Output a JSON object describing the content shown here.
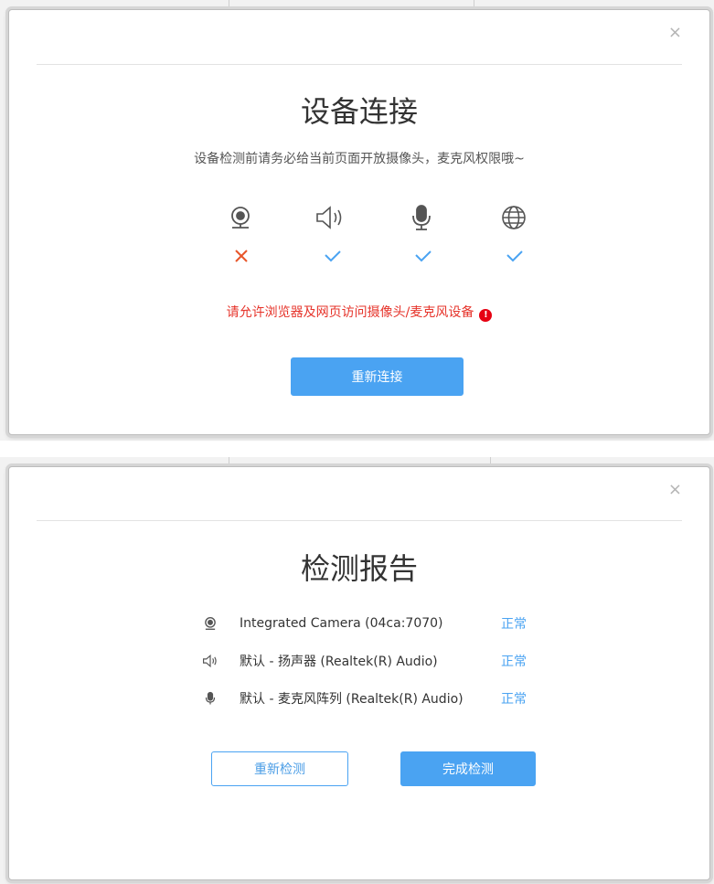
{
  "connect_dialog": {
    "close_label": "×",
    "title": "设备连接",
    "subtitle": "设备检测前请务必给当前页面开放摄像头，麦克风权限哦~",
    "devices": [
      {
        "icon": "camera-icon",
        "status": "fail"
      },
      {
        "icon": "speaker-icon",
        "status": "ok"
      },
      {
        "icon": "microphone-icon",
        "status": "ok"
      },
      {
        "icon": "network-globe-icon",
        "status": "ok"
      }
    ],
    "warning_text": "请允许浏览器及网页访问摄像头/麦克风设备",
    "warning_icon_glyph": "!",
    "reconnect_button": "重新连接"
  },
  "report_dialog": {
    "close_label": "×",
    "title": "检测报告",
    "rows": [
      {
        "icon": "camera-icon",
        "name": "Integrated Camera (04ca:7070)",
        "status": "正常"
      },
      {
        "icon": "speaker-icon",
        "name": "默认 - 扬声器 (Realtek(R) Audio)",
        "status": "正常"
      },
      {
        "icon": "microphone-icon",
        "name": "默认 - 麦克风阵列 (Realtek(R) Audio)",
        "status": "正常"
      }
    ],
    "recheck_button": "重新检测",
    "finish_button": "完成检测"
  },
  "colors": {
    "primary": "#4aa3f2",
    "success_check": "#4aa3f2",
    "fail_cross": "#e8562a",
    "warning_text": "#e6332a",
    "icon_gray": "#555555"
  }
}
